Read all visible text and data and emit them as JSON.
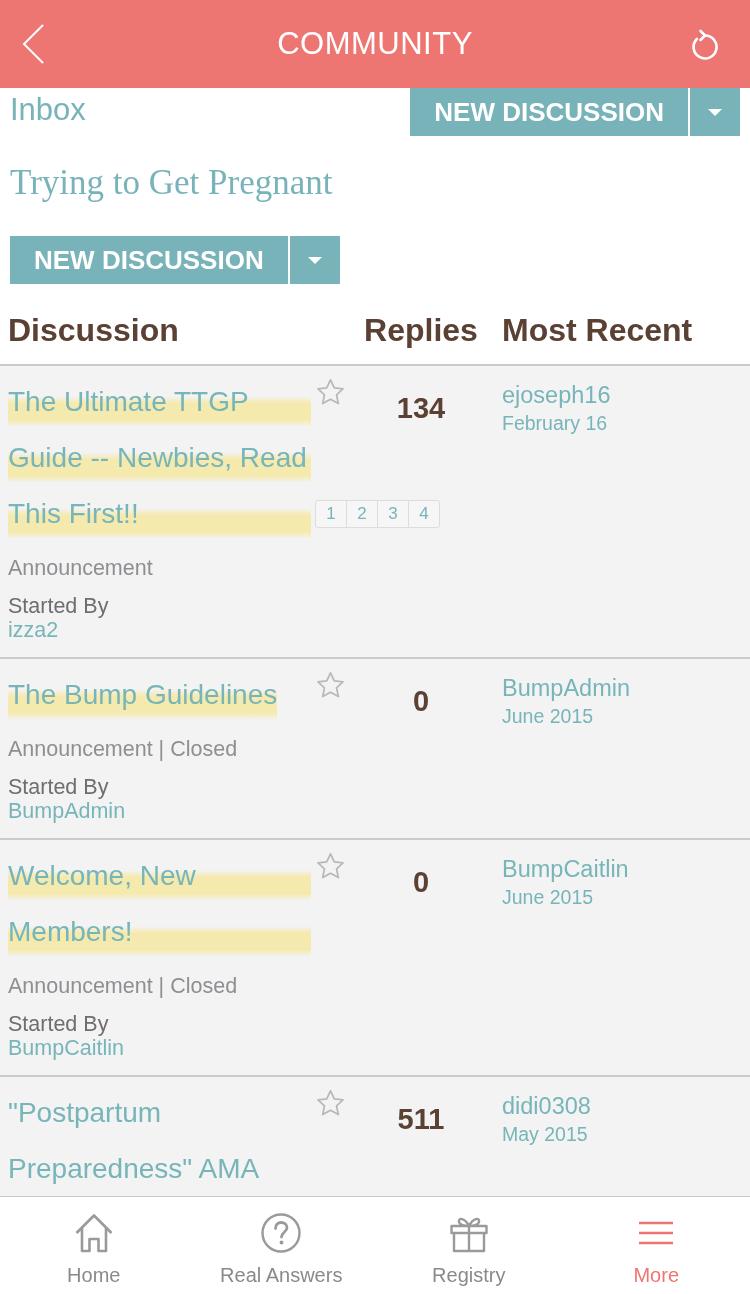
{
  "header": {
    "title": "COMMUNITY"
  },
  "toolbar": {
    "inbox": "Inbox",
    "button": {
      "label": "NEW DISCUSSION"
    }
  },
  "board": {
    "title": "Trying to Get Pregnant",
    "button": {
      "label": "NEW DISCUSSION"
    }
  },
  "table": {
    "columns": [
      "Discussion",
      "Replies",
      "Most Recent"
    ],
    "rows": [
      {
        "title": "The Ultimate TTGP Guide -- Newbies, Read This First!!",
        "highlighted": true,
        "starred": false,
        "pages": [
          "1",
          "2",
          "3",
          "4"
        ],
        "category": "Announcement",
        "started_by": "Started By",
        "author": "izza2",
        "replies": "134",
        "recent_user": "ejoseph16",
        "recent_date": "February 16"
      },
      {
        "title": "The Bump Guidelines",
        "highlighted": true,
        "starred": false,
        "category": "Announcement | Closed",
        "started_by": "Started By",
        "author": "BumpAdmin",
        "replies": "0",
        "recent_user": "BumpAdmin",
        "recent_date": "June 2015"
      },
      {
        "title": "Welcome, New Members!",
        "highlighted": true,
        "starred": false,
        "category": "Announcement | Closed",
        "started_by": "Started By",
        "author": "BumpCaitlin",
        "replies": "0",
        "recent_user": "BumpCaitlin",
        "recent_date": "June 2015"
      },
      {
        "title": "\"Postpartum Preparedness\" AMA",
        "highlighted": false,
        "starred": false,
        "replies": "511",
        "recent_user": "didi0308",
        "recent_date": "May 2015"
      }
    ]
  },
  "nav": [
    {
      "label": "Home",
      "kind": "home",
      "selected": false
    },
    {
      "label": "Real Answers",
      "kind": "question",
      "selected": false
    },
    {
      "label": "Registry",
      "kind": "gift",
      "selected": false
    },
    {
      "label": "More",
      "kind": "menu",
      "selected": true
    }
  ]
}
